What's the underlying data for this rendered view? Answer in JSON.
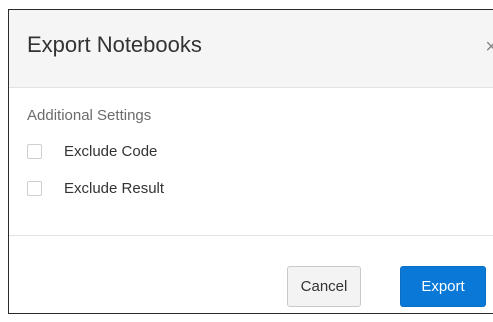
{
  "dialog": {
    "title": "Export Notebooks",
    "close_glyph": "×",
    "close_icon": "close-icon"
  },
  "settings": {
    "section_label": "Additional Settings",
    "options": [
      {
        "label": "Exclude Code",
        "checked": false
      },
      {
        "label": "Exclude Result",
        "checked": false
      }
    ]
  },
  "footer": {
    "cancel_label": "Cancel",
    "export_label": "Export"
  },
  "colors": {
    "primary": "#0a78d7",
    "header_bg": "#f5f5f5"
  }
}
